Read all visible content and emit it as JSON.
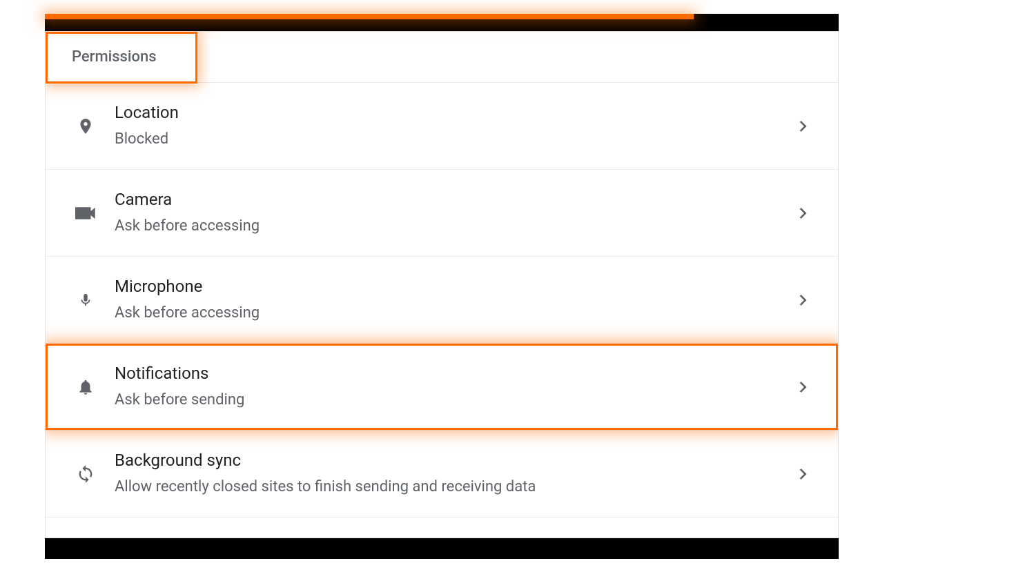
{
  "section": {
    "title": "Permissions"
  },
  "permissions": [
    {
      "icon": "location-icon",
      "title": "Location",
      "subtitle": "Blocked",
      "highlighted": false
    },
    {
      "icon": "camera-icon",
      "title": "Camera",
      "subtitle": "Ask before accessing",
      "highlighted": false
    },
    {
      "icon": "microphone-icon",
      "title": "Microphone",
      "subtitle": "Ask before accessing",
      "highlighted": false
    },
    {
      "icon": "bell-icon",
      "title": "Notifications",
      "subtitle": "Ask before sending",
      "highlighted": true
    },
    {
      "icon": "sync-icon",
      "title": "Background sync",
      "subtitle": "Allow recently closed sites to finish sending and receiving data",
      "highlighted": false
    }
  ],
  "colors": {
    "highlight": "#ff6b00",
    "text_primary": "#202124",
    "text_secondary": "#5f6368"
  }
}
